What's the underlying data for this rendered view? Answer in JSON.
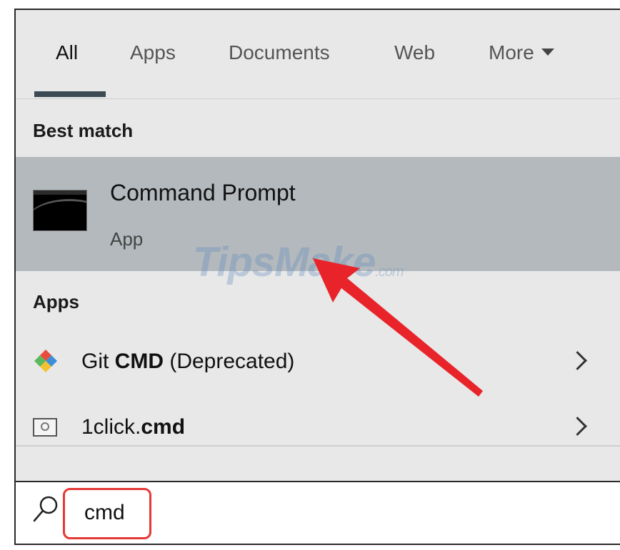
{
  "tabs": [
    {
      "label": "All",
      "active": true
    },
    {
      "label": "Apps"
    },
    {
      "label": "Documents"
    },
    {
      "label": "Web"
    },
    {
      "label": "More"
    }
  ],
  "best_match": {
    "heading": "Best match",
    "title": "Command Prompt",
    "subtitle": "App"
  },
  "apps": {
    "heading": "Apps",
    "items": [
      {
        "prefix": "Git ",
        "bold": "CMD",
        "suffix": " (Deprecated)",
        "icon": "git-icon"
      },
      {
        "prefix": "1click.",
        "bold": "cmd",
        "suffix": "",
        "icon": "file-icon"
      }
    ]
  },
  "search": {
    "value": "cmd"
  },
  "watermark": {
    "text": "TipsMake",
    "suffix": ".com"
  },
  "colors": {
    "selected_row": "#b3b9bd",
    "panel_bg": "#e8e8e8",
    "tab_underline": "#3b4a54",
    "annotation_red": "#e53935"
  }
}
